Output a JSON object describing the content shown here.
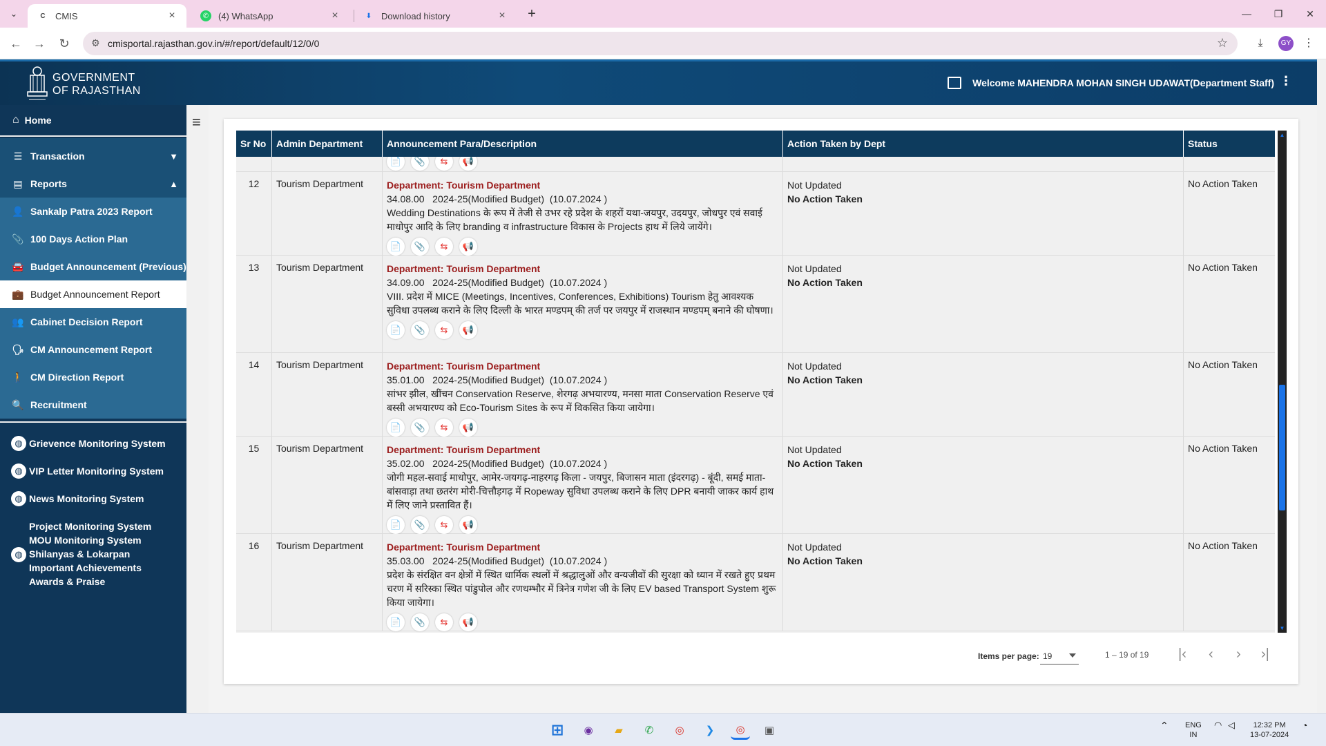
{
  "browser": {
    "tabs": [
      {
        "label": "CMIS",
        "icon": "cmis-favicon-icon",
        "active": true
      },
      {
        "label": "(4) WhatsApp",
        "icon": "whatsapp-icon",
        "active": false
      },
      {
        "label": "Download history",
        "icon": "download-icon",
        "active": false
      }
    ],
    "url": "cmisportal.rajasthan.gov.in/#/report/default/12/0/0",
    "profile_initials": "GY"
  },
  "header": {
    "title_line1": "GOVERNMENT",
    "title_line2": "OF RAJASTHAN",
    "welcome": "Welcome MAHENDRA MOHAN SINGH UDAWAT(Department Staff)"
  },
  "sidebar": {
    "home": "Home",
    "transaction": "Transaction",
    "reports": "Reports",
    "report_items": [
      {
        "label": "Sankalp Patra 2023 Report",
        "icon": "user-add-icon"
      },
      {
        "label": "100 Days Action Plan",
        "icon": "paperclip-icon"
      },
      {
        "label": "Budget Announcement (Previous)",
        "icon": "car-icon"
      },
      {
        "label": "Budget Announcement Report",
        "icon": "briefcase-icon"
      },
      {
        "label": "Cabinet Decision Report",
        "icon": "group-icon"
      },
      {
        "label": "CM Announcement Report",
        "icon": "speaker-user-icon"
      },
      {
        "label": "CM Direction Report",
        "icon": "walking-icon"
      },
      {
        "label": "Recruitment",
        "icon": "user-search-icon"
      }
    ],
    "systems": [
      "Grievence Monitoring System",
      "VIP Letter Monitoring System",
      "News Monitoring System"
    ],
    "other_links": [
      "Project Monitoring System",
      "MOU Monitoring System",
      "Shilanyas & Lokarpan",
      "Important Achievements",
      "Awards & Praise"
    ]
  },
  "table": {
    "headers": [
      "Sr No",
      "Admin Department",
      "Announcement Para/Description",
      "Action Taken by Dept",
      "Status"
    ],
    "rows": [
      {
        "sr": "12",
        "admin": "Tourism Department",
        "dept_line": "Department: Tourism Department",
        "meta": "34.08.00   2024-25(Modified Budget)  (10.07.2024 )",
        "desc": "Wedding Destinations के रूप में तेजी से उभर रहे प्रदेश के शहरों यथा-जयपुर, उदयपुर, जोधपुर एवं सवाई माधोपुर आदि के लिए branding व infrastructure विकास के Projects हाथ में लिये जायेंगे।",
        "action1": "Not Updated",
        "action2": "No Action Taken",
        "status": "No Action Taken"
      },
      {
        "sr": "13",
        "admin": "Tourism Department",
        "dept_line": "Department: Tourism Department",
        "meta": "34.09.00   2024-25(Modified Budget)  (10.07.2024 )",
        "desc": "VIII. प्रदेश में MICE (Meetings, Incentives, Conferences, Exhibitions) Tourism हेतु आवश्यक सुविधा उपलब्ध कराने के लिए दिल्ली के भारत मण्डपम् की तर्ज पर जयपुर में राजस्थान मण्डपम् बनाने की घोषणा।",
        "action1": "Not Updated",
        "action2": "No Action Taken",
        "status": "No Action Taken"
      },
      {
        "sr": "14",
        "admin": "Tourism Department",
        "dept_line": "Department: Tourism Department",
        "meta": "35.01.00   2024-25(Modified Budget)  (10.07.2024 )",
        "desc": "सांभर झील, खींचन Conservation Reserve, शेरगढ़ अभयारण्य, मनसा माता Conservation Reserve एवं बस्सी अभयारण्य को Eco-Tourism Sites के रूप में विकसित किया जायेगा।",
        "action1": "Not Updated",
        "action2": "No Action Taken",
        "status": "No Action Taken"
      },
      {
        "sr": "15",
        "admin": "Tourism Department",
        "dept_line": "Department: Tourism Department",
        "meta": "35.02.00   2024-25(Modified Budget)  (10.07.2024 )",
        "desc": "जोगी महल-सवाई माधोपुर, आमेर-जयगढ़-नाहरगढ़ किला - जयपुर, बिजासन माता (इंदरगढ़) - बूंदी, समई माता-बांसवाड़ा तथा छतरंग मोरी-चित्तौड़गढ़ में Ropeway सुविधा उपलब्ध कराने के लिए DPR बनायी जाकर कार्य हाथ में लिए जाने प्रस्तावित हैं।",
        "action1": "Not Updated",
        "action2": "No Action Taken",
        "status": "No Action Taken"
      },
      {
        "sr": "16",
        "admin": "Tourism Department",
        "dept_line": "Department: Tourism Department",
        "meta": "35.03.00   2024-25(Modified Budget)  (10.07.2024 )",
        "desc": "प्रदेश के संरक्षित वन क्षेत्रों में स्थित धार्मिक स्थलों में श्रद्धालुओं और वन्यजीवों की सुरक्षा को ध्यान में रखते हुए प्रथम चरण में सरिस्का स्थित पांडुपोल और रणथम्भौर में त्रिनेत्र गणेश जी के लिए EV based Transport System शुरू किया जायेगा।",
        "action1": "Not Updated",
        "action2": "No Action Taken",
        "status": "No Action Taken"
      }
    ]
  },
  "paginator": {
    "items_per_page_label": "Items per page:",
    "items_per_page": "19",
    "range": "1 – 19 of 19"
  },
  "taskbar": {
    "lang1": "ENG",
    "lang2": "IN",
    "time": "12:32 PM",
    "date": "13-07-2024"
  },
  "colors": {
    "header_bg": "#0c3d68",
    "sidebar_bg": "#0f3658",
    "table_header_bg": "#0d3b5d",
    "dept_red": "#9b1c1c",
    "accent_blue": "#1a73e8"
  }
}
